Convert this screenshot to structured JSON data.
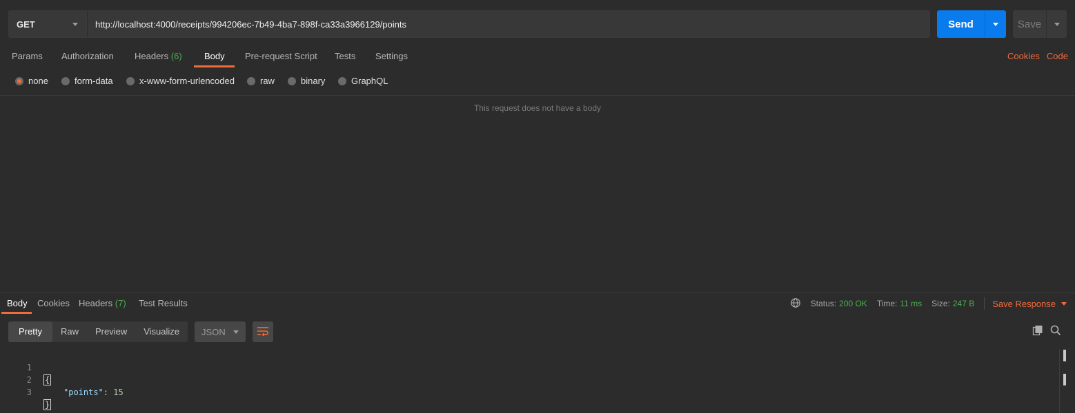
{
  "request": {
    "method": "GET",
    "url": "http://localhost:4000/receipts/994206ec-7b49-4ba7-898f-ca33a3966129/points",
    "send_label": "Send",
    "save_label": "Save"
  },
  "request_tabs": {
    "params": "Params",
    "authorization": "Authorization",
    "headers": "Headers",
    "headers_count": "(6)",
    "body": "Body",
    "prerequest": "Pre-request Script",
    "tests": "Tests",
    "settings": "Settings",
    "active": "Body"
  },
  "right_links": {
    "cookies": "Cookies",
    "code": "Code"
  },
  "body_types": {
    "selected": "none",
    "options": [
      "none",
      "form-data",
      "x-www-form-urlencoded",
      "raw",
      "binary",
      "GraphQL"
    ]
  },
  "body_empty_message": "This request does not have a body",
  "response_tabs": {
    "body": "Body",
    "cookies": "Cookies",
    "headers": "Headers",
    "headers_count": "(7)",
    "test_results": "Test Results",
    "active": "Body"
  },
  "response_status": {
    "status_label": "Status:",
    "status_value": "200 OK",
    "time_label": "Time:",
    "time_value": "11 ms",
    "size_label": "Size:",
    "size_value": "247 B",
    "save_response": "Save Response"
  },
  "viewer": {
    "modes": [
      "Pretty",
      "Raw",
      "Preview",
      "Visualize"
    ],
    "active_mode": "Pretty",
    "format": "JSON"
  },
  "code_lines": [
    {
      "n": "1",
      "open": "{"
    },
    {
      "n": "2",
      "key": "\"points\"",
      "sep": ": ",
      "value": "15"
    },
    {
      "n": "3",
      "close": "}"
    }
  ],
  "colors": {
    "accent": "#f26b3a",
    "primary": "#097bed",
    "success": "#4caf50",
    "background": "#2c2c2c"
  },
  "icons": [
    "chevron-down-icon",
    "globe-icon",
    "wrap-lines-icon",
    "copy-icon",
    "search-icon"
  ]
}
